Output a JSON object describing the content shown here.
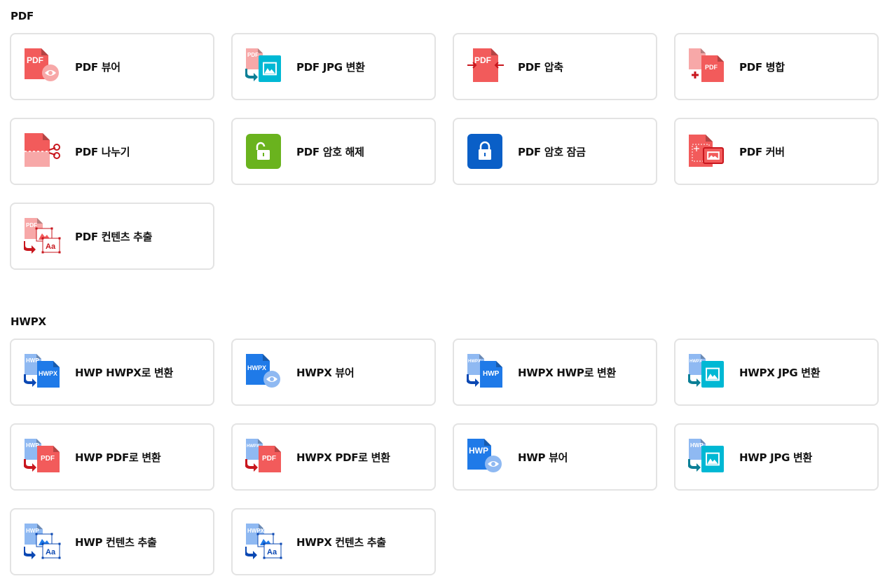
{
  "sections": [
    {
      "title": "PDF",
      "items": [
        {
          "label": "PDF 뷰어",
          "icon": "pdf-viewer-icon"
        },
        {
          "label": "PDF JPG 변환",
          "icon": "pdf-to-jpg-icon"
        },
        {
          "label": "PDF 압축",
          "icon": "pdf-compress-icon"
        },
        {
          "label": "PDF 병합",
          "icon": "pdf-merge-icon"
        },
        {
          "label": "PDF 나누기",
          "icon": "pdf-split-icon"
        },
        {
          "label": "PDF 암호 해제",
          "icon": "unlock-icon"
        },
        {
          "label": "PDF 암호 잠금",
          "icon": "lock-icon"
        },
        {
          "label": "PDF 커버",
          "icon": "pdf-cover-icon"
        },
        {
          "label": "PDF 컨텐츠 추출",
          "icon": "pdf-extract-icon"
        }
      ]
    },
    {
      "title": "HWPX",
      "items": [
        {
          "label": "HWP HWPX로 변환",
          "icon": "hwp-to-hwpx-icon"
        },
        {
          "label": "HWPX 뷰어",
          "icon": "hwpx-viewer-icon"
        },
        {
          "label": "HWPX HWP로 변환",
          "icon": "hwpx-to-hwp-icon"
        },
        {
          "label": "HWPX JPG 변환",
          "icon": "hwpx-to-jpg-icon"
        },
        {
          "label": "HWP PDF로 변환",
          "icon": "hwp-to-pdf-icon"
        },
        {
          "label": "HWPX PDF로 변환",
          "icon": "hwpx-to-pdf-icon"
        },
        {
          "label": "HWP 뷰어",
          "icon": "hwp-viewer-icon"
        },
        {
          "label": "HWP JPG 변환",
          "icon": "hwp-to-jpg-icon"
        },
        {
          "label": "HWP 컨텐츠 추출",
          "icon": "hwp-extract-icon"
        },
        {
          "label": "HWPX 컨텐츠 추출",
          "icon": "hwpx-extract-icon"
        }
      ]
    }
  ],
  "icon_text": {
    "pdf": "PDF",
    "hwp": "HWP",
    "hwpx": "HWPX",
    "aa": "Aa"
  },
  "colors": {
    "pdf_red": "#f25b5b",
    "pdf_light": "#f7a8a8",
    "pdf_dark": "#c8161d",
    "hwp_blue": "#1f7ae8",
    "hwp_light": "#8fb9f2",
    "hwp_dark": "#0b48b3",
    "jpg_teal": "#00b8d4",
    "teal_dark": "#0b7f96",
    "unlock_green": "#6ab31e",
    "lock_blue": "#0a5fc7"
  }
}
